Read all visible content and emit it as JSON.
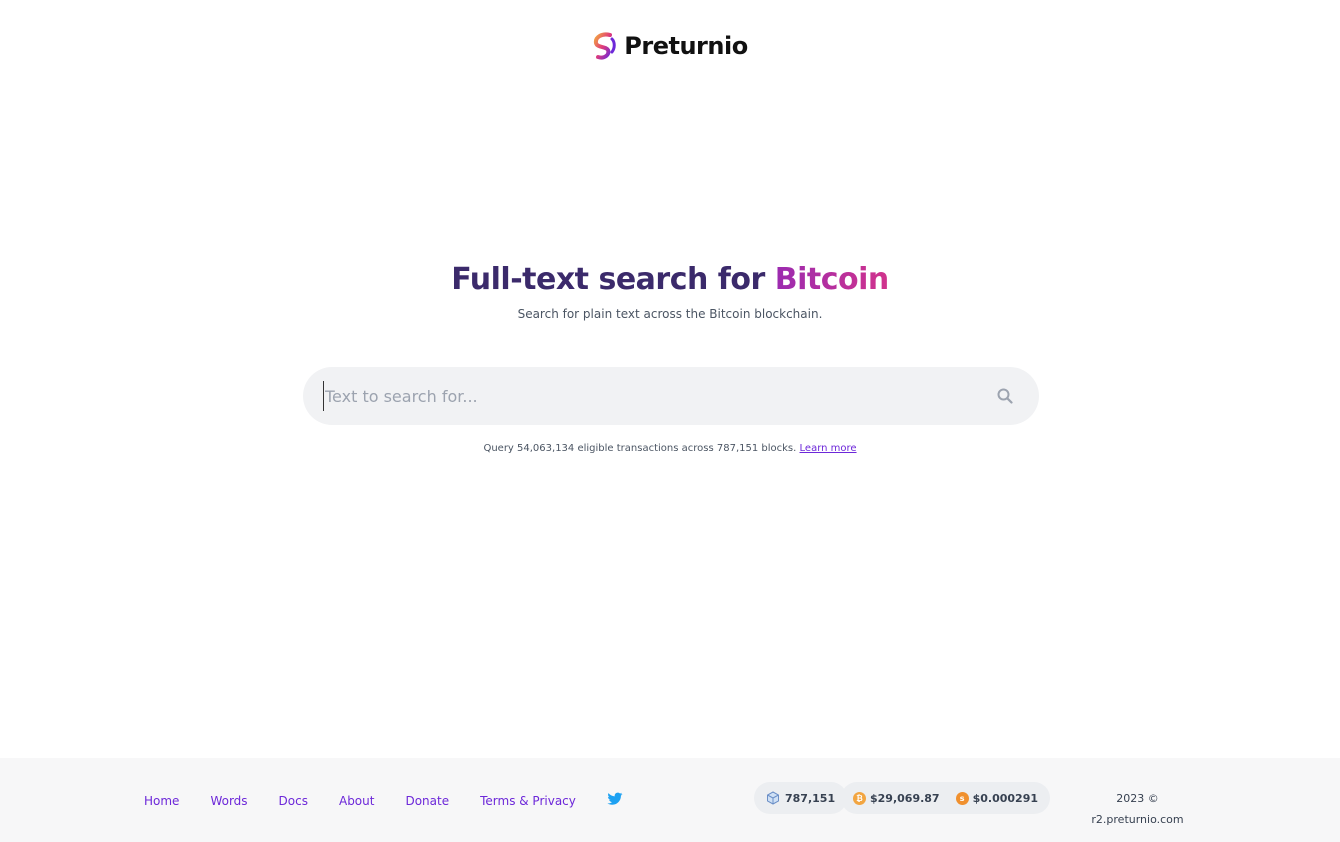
{
  "brand": {
    "name": "Preturnio",
    "colors": {
      "primary": "#6d28d9",
      "accent_start": "#9b2bb0",
      "accent_end": "#d1338c",
      "title": "#3b2a6b"
    }
  },
  "hero": {
    "title_prefix": "Full-text search for ",
    "title_accent": "Bitcoin",
    "subtitle": "Search for plain text across the Bitcoin blockchain."
  },
  "search": {
    "placeholder": "Text to search for...",
    "value": "",
    "icon": "search-icon"
  },
  "stats": {
    "prefix": "Query 54,063,134 eligible transactions across 787,151 blocks.",
    "link_label": "Learn more"
  },
  "footer": {
    "nav": [
      "Home",
      "Words",
      "Docs",
      "About",
      "Donate",
      "Terms & Privacy"
    ],
    "social_icon": "twitter-icon",
    "block_height": "787,151",
    "btc_price": "$29,069.87",
    "sat_price": "$0.000291",
    "copyright_line1": "2023 ©",
    "copyright_line2": "r2.preturnio.com"
  }
}
